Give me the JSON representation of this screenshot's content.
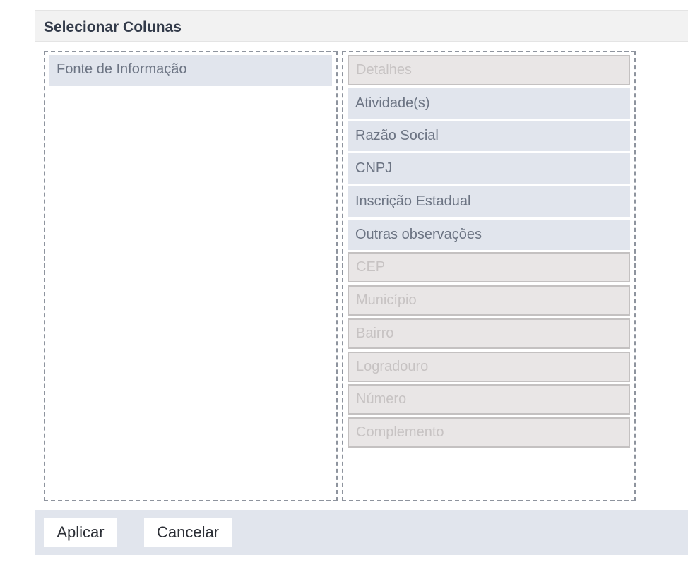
{
  "dialog": {
    "title": "Selecionar Colunas"
  },
  "left_panel": {
    "items": [
      {
        "label": "Fonte de Informação",
        "state": "active"
      }
    ]
  },
  "right_panel": {
    "items": [
      {
        "label": "Detalhes",
        "state": "disabled"
      },
      {
        "label": "Atividade(s)",
        "state": "active"
      },
      {
        "label": "Razão Social",
        "state": "active"
      },
      {
        "label": "CNPJ",
        "state": "active"
      },
      {
        "label": "Inscrição Estadual",
        "state": "active"
      },
      {
        "label": "Outras observações",
        "state": "active"
      },
      {
        "label": "CEP",
        "state": "disabled"
      },
      {
        "label": "Município",
        "state": "disabled"
      },
      {
        "label": "Bairro",
        "state": "disabled"
      },
      {
        "label": "Logradouro",
        "state": "disabled"
      },
      {
        "label": "Número",
        "state": "disabled"
      },
      {
        "label": "Complemento",
        "state": "disabled"
      }
    ]
  },
  "footer": {
    "apply_label": "Aplicar",
    "cancel_label": "Cancelar"
  },
  "colors": {
    "active_bg": "#e1e5ed",
    "disabled_bg": "#e9e6e6",
    "panel_border": "#8e949e"
  }
}
